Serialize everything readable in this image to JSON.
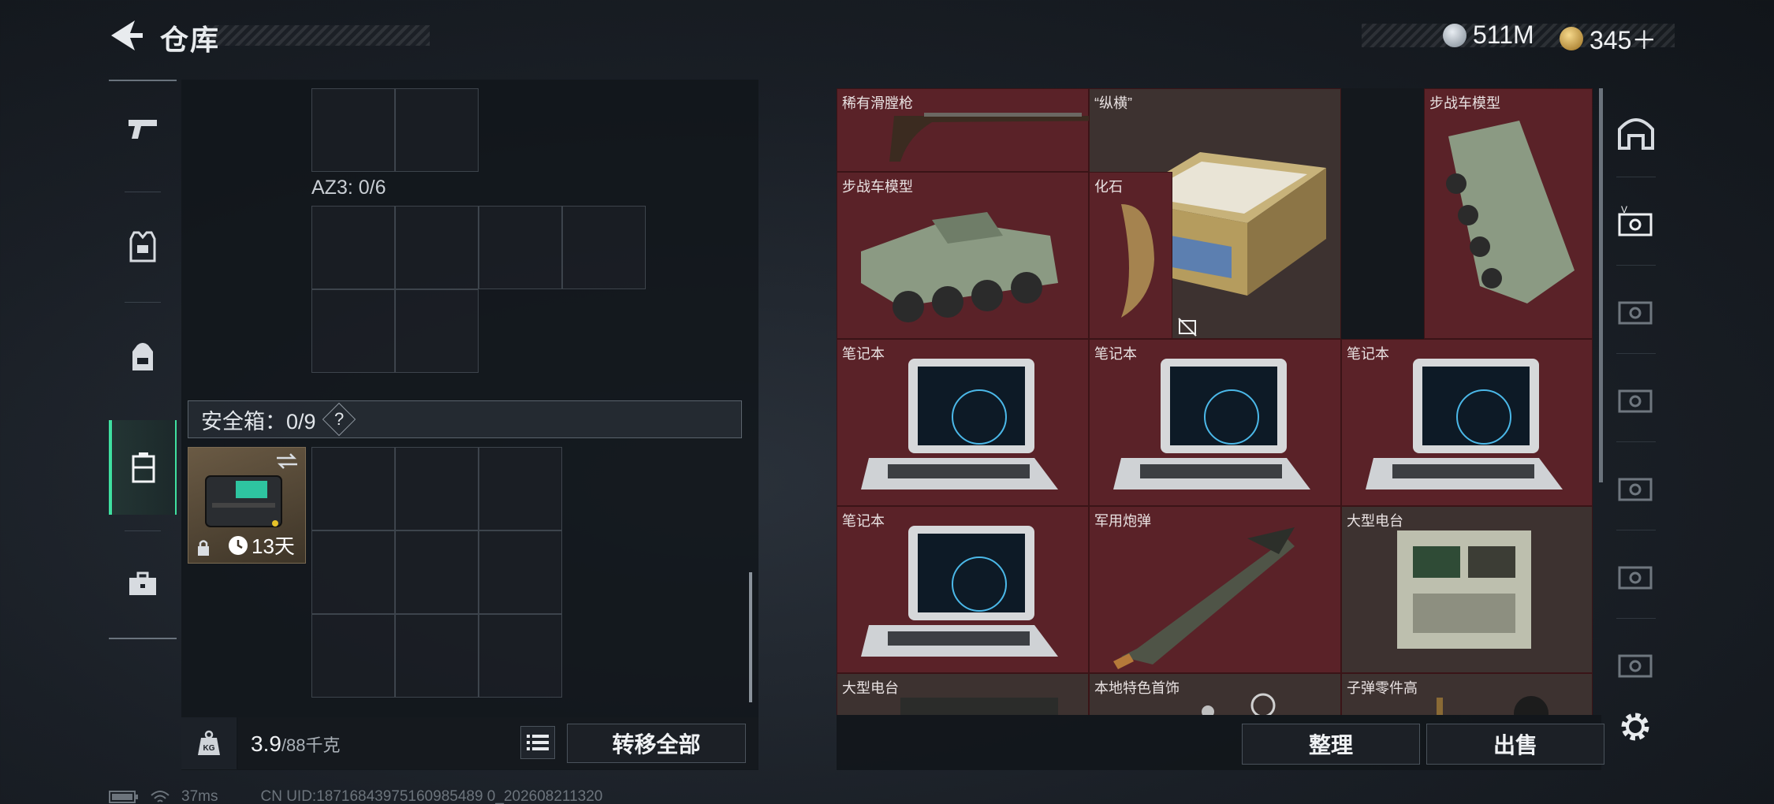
{
  "header": {
    "title": "仓库",
    "currencies": [
      {
        "name": "hafcoin",
        "value": "511M",
        "color": "#b9c2cc"
      },
      {
        "name": "gold-coin",
        "value": "345＋",
        "color": "#d4a84a"
      }
    ]
  },
  "left_rail": {
    "items": [
      {
        "id": "weapon",
        "icon": "pistol-icon"
      },
      {
        "id": "armor",
        "icon": "vest-icon"
      },
      {
        "id": "backpack",
        "icon": "backpack-icon"
      },
      {
        "id": "safebox",
        "icon": "safebox-icon",
        "active": true
      },
      {
        "id": "tools",
        "icon": "toolbox-icon"
      }
    ]
  },
  "loadout": {
    "az3_label": "AZ3: 0/6",
    "safebox_label": "安全箱：0/9",
    "safebox_help": "?",
    "safebox_item_duration": "13天",
    "weight_value": "3.9",
    "weight_max": "/88千克",
    "weight_icon_text": "KG",
    "transfer_all": "转移全部"
  },
  "stash": {
    "items": [
      {
        "label": "稀有滑膛枪"
      },
      {
        "label": "“纵横”"
      },
      {
        "label": "步战车模型"
      },
      {
        "label": "步战车模型"
      },
      {
        "label": "化石"
      },
      {
        "label": "笔记本"
      },
      {
        "label": "笔记本"
      },
      {
        "label": "笔记本"
      },
      {
        "label": "笔记本"
      },
      {
        "label": "军用炮弹"
      },
      {
        "label": "大型电台"
      },
      {
        "label": "大型电台"
      },
      {
        "label": "本地特色首饰"
      },
      {
        "label": "子弹零件高"
      }
    ],
    "sort_button": "整理",
    "sell_button": "出售"
  },
  "status": {
    "ping": "37ms",
    "uid": "CN UID:18716843975160985489 0_202608211320"
  }
}
